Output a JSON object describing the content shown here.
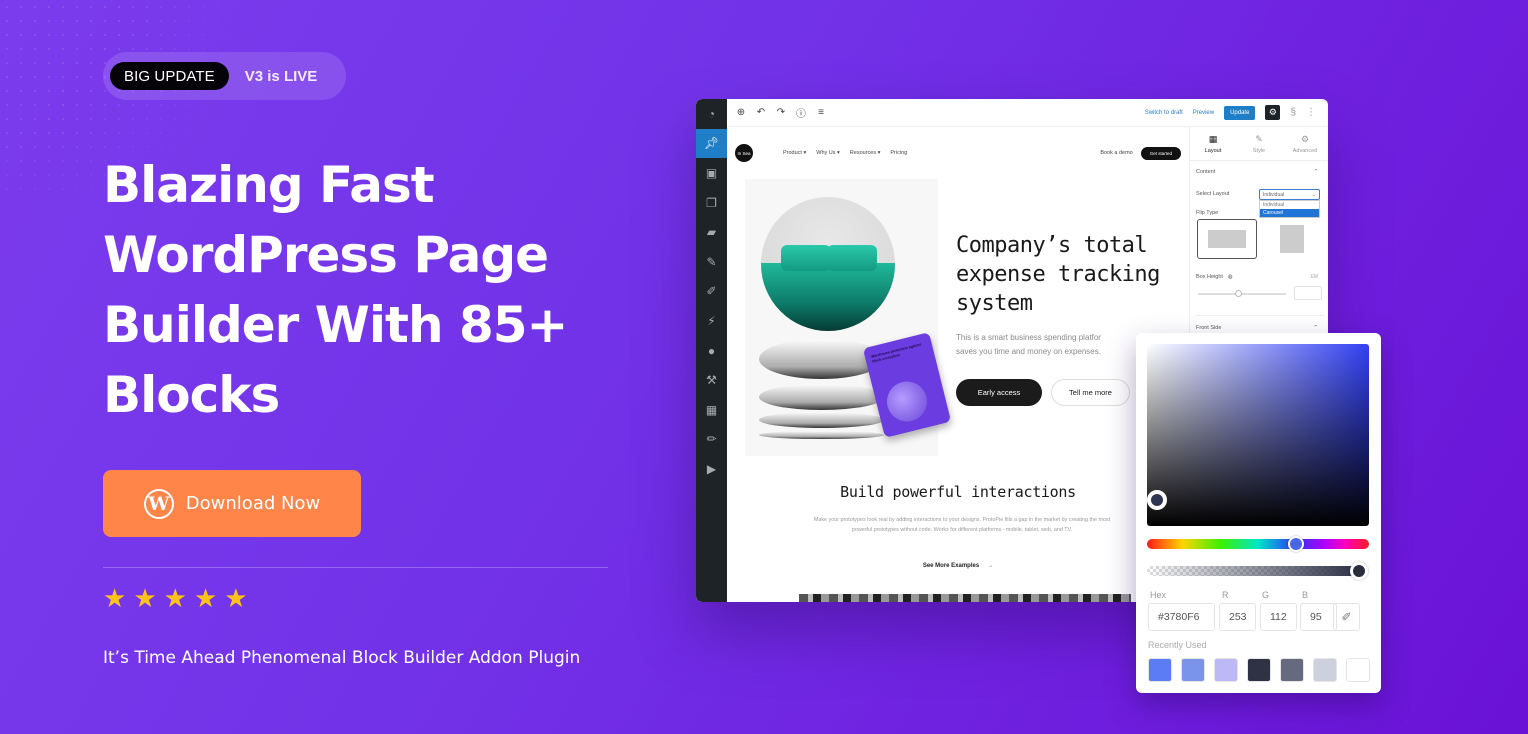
{
  "badge": {
    "tag": "BIG UPDATE",
    "text": "V3 is LIVE"
  },
  "headline": "Blazing Fast WordPress Page Builder With 85+ Blocks",
  "cta": {
    "label": "Download Now",
    "icon": "wordpress-icon",
    "color": "#FF8549"
  },
  "rating": {
    "stars": 5,
    "max": 5,
    "color": "#FFC21A"
  },
  "tagline": "It’s Time Ahead Phenomenal Block Builder Addon Plugin",
  "theme": {
    "background": "#7233E8",
    "accent": "#FF8549"
  },
  "editor": {
    "sidebar_icons": [
      "dashboard-icon",
      "pin-icon",
      "media-icon",
      "pages-icon",
      "comments-icon",
      "pin-icon",
      "brush-icon",
      "plugins-icon",
      "users-icon",
      "tools-icon",
      "settings-icon",
      "pencil-icon",
      "play-icon"
    ],
    "toolbar": {
      "icons": [
        "add-icon",
        "undo-icon",
        "redo-icon",
        "info-icon",
        "list-view-icon"
      ],
      "switch_to_draft": "Switch to draft",
      "preview": "Preview",
      "update": "Update"
    },
    "page": {
      "logo_text": "In Sea",
      "nav": [
        "Product ▾",
        "Why Us ▾",
        "Resources ▾",
        "Pricing"
      ],
      "book_demo": "Book a demo",
      "get_started": "Get started",
      "card_text": "Warehouse protection against block corruption",
      "hero_title": "Company’s total expense tracking system",
      "hero_sub_1": "This is a smart business spending platfor",
      "hero_sub_2": "saves you time and money on expenses.",
      "btn_early": "Early access",
      "btn_tell": "Tell me more",
      "section_title": "Build powerful interactions",
      "section_body": "Make your prototypes look real by adding interactions to your designs. ProtoPie fills a gap in the market by creating the most powerful prototypes without code. Works for different platforms - mobile, tablet, web, and TV.",
      "see_more": "See More Examples"
    },
    "panel": {
      "tabs": [
        {
          "label": "Layout",
          "icon": "layout-icon",
          "active": true
        },
        {
          "label": "Style",
          "icon": "pencil-icon",
          "active": false
        },
        {
          "label": "Advanced",
          "icon": "gear-icon",
          "active": false
        }
      ],
      "content_heading": "Content",
      "select_layout_label": "Select Layout",
      "select_layout_value": "Individual",
      "select_options": [
        "Individual",
        "Carousel"
      ],
      "select_highlighted": "Carousel",
      "flip_type_label": "Flip Type",
      "box_height_label": "Box Height",
      "box_height_unit": "EM",
      "front_side_heading": "Front Side"
    }
  },
  "color_picker": {
    "hex_label": "Hex",
    "hex_value": "#3780F6",
    "r_label": "R",
    "r_value": "253",
    "g_label": "G",
    "g_value": "112",
    "b_label": "B",
    "b_value": "95",
    "recent_label": "Recently Used",
    "recent_colors": [
      "#5B7CF4",
      "#7A93EB",
      "#BDB9F7",
      "#2E3244",
      "#666A7E",
      "#CDD1DE",
      "#FFFFFF"
    ]
  }
}
